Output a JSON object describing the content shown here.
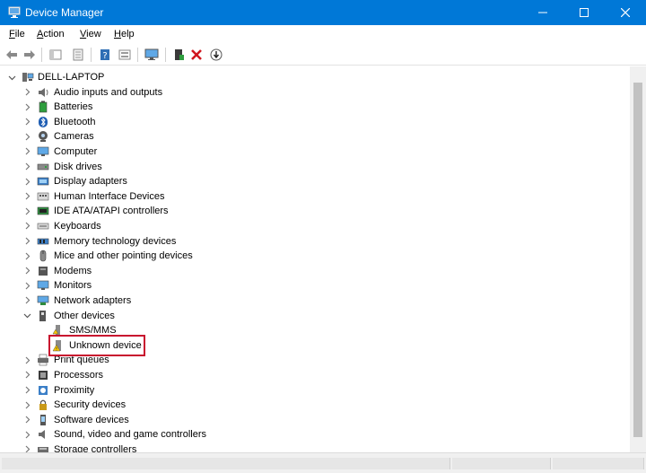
{
  "window": {
    "title": "Device Manager",
    "accent": "#0078d7"
  },
  "menu": [
    {
      "label": "File",
      "key": "F",
      "rest": "ile"
    },
    {
      "label": "Action",
      "key": "A",
      "rest": "ction"
    },
    {
      "label": "View",
      "key": "V",
      "rest": "iew"
    },
    {
      "label": "Help",
      "key": "H",
      "rest": "elp"
    }
  ],
  "toolbar": {
    "buttons": [
      "back-arrow-icon",
      "forward-arrow-icon",
      "show-hide-tree-icon",
      "properties-icon",
      "help-icon",
      "view-icon",
      "monitor-icon",
      "update-driver-icon",
      "uninstall-icon",
      "scan-changes-icon"
    ]
  },
  "tree": {
    "root": "DELL-LAPTOP",
    "items": [
      {
        "label": "Audio inputs and outputs",
        "icon": "speaker-icon"
      },
      {
        "label": "Batteries",
        "icon": "battery-icon"
      },
      {
        "label": "Bluetooth",
        "icon": "bluetooth-icon"
      },
      {
        "label": "Cameras",
        "icon": "camera-icon"
      },
      {
        "label": "Computer",
        "icon": "computer-icon"
      },
      {
        "label": "Disk drives",
        "icon": "disk-icon"
      },
      {
        "label": "Display adapters",
        "icon": "display-adapter-icon"
      },
      {
        "label": "Human Interface Devices",
        "icon": "hid-icon"
      },
      {
        "label": "IDE ATA/ATAPI controllers",
        "icon": "ide-icon"
      },
      {
        "label": "Keyboards",
        "icon": "keyboard-icon"
      },
      {
        "label": "Memory technology devices",
        "icon": "memory-icon"
      },
      {
        "label": "Mice and other pointing devices",
        "icon": "mouse-icon"
      },
      {
        "label": "Modems",
        "icon": "modem-icon"
      },
      {
        "label": "Monitors",
        "icon": "monitor-icon"
      },
      {
        "label": "Network adapters",
        "icon": "network-icon"
      },
      {
        "label": "Other devices",
        "icon": "other-devices-icon",
        "expanded": true,
        "children": [
          {
            "label": "SMS/MMS",
            "icon": "sms-icon"
          },
          {
            "label": "Unknown device",
            "icon": "warning-device-icon",
            "highlighted": true
          }
        ]
      },
      {
        "label": "Print queues",
        "icon": "printer-icon"
      },
      {
        "label": "Processors",
        "icon": "processor-icon"
      },
      {
        "label": "Proximity",
        "icon": "proximity-icon"
      },
      {
        "label": "Security devices",
        "icon": "security-icon"
      },
      {
        "label": "Software devices",
        "icon": "software-icon"
      },
      {
        "label": "Sound, video and game controllers",
        "icon": "sound-icon"
      },
      {
        "label": "Storage controllers",
        "icon": "storage-icon"
      }
    ]
  }
}
